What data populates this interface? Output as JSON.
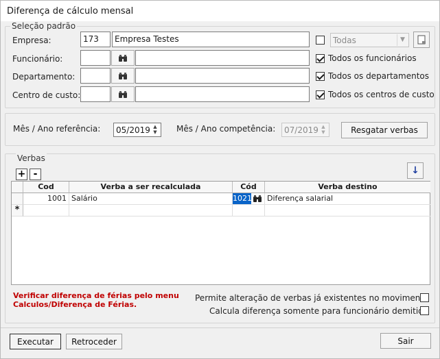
{
  "window": {
    "title": "Diferença de cálculo mensal"
  },
  "selecao": {
    "legend": "Seleção padrão",
    "empresa_label": "Empresa:",
    "empresa_code": "173",
    "empresa_name": "Empresa Testes",
    "funcionario_label": "Funcionário:",
    "departamento_label": "Departamento:",
    "centro_label": "Centro de custo:",
    "todas_value": "Todas",
    "todos_funcionarios": "Todos os funcionários",
    "todos_departamentos": "Todos os departamentos",
    "todos_centros": "Todos os centros de custo"
  },
  "periodo": {
    "referencia_label": "Mês / Ano referência:",
    "referencia_value": "05/2019",
    "competencia_label": "Mês / Ano competência:",
    "competencia_value": "07/2019",
    "resgatar_button": "Resgatar verbas"
  },
  "verbas": {
    "legend": "Verbas",
    "add_label": "+",
    "remove_label": "-",
    "new_row_marker": "*",
    "columns": {
      "cod": "Cod",
      "verba_recalc": "Verba a ser recalculada",
      "cod_dest": "Cód",
      "verba_destino": "Verba destino"
    },
    "rows": [
      {
        "cod": "1001",
        "verba": "Salário",
        "cod_dest": "1021",
        "verba_destino": "Diferença salarial"
      }
    ]
  },
  "aviso": {
    "line1": "Verificar diferença de férias pelo menu",
    "line2": "Calculos/Diferença de Férias."
  },
  "opcoes": {
    "permite_label": "Permite alteração de verbas já existentes no movimento",
    "calcula_label": "Calcula diferença somente para funcionário demitido"
  },
  "buttons": {
    "executar": "Executar",
    "retroceder": "Retroceder",
    "sair": "Sair"
  }
}
